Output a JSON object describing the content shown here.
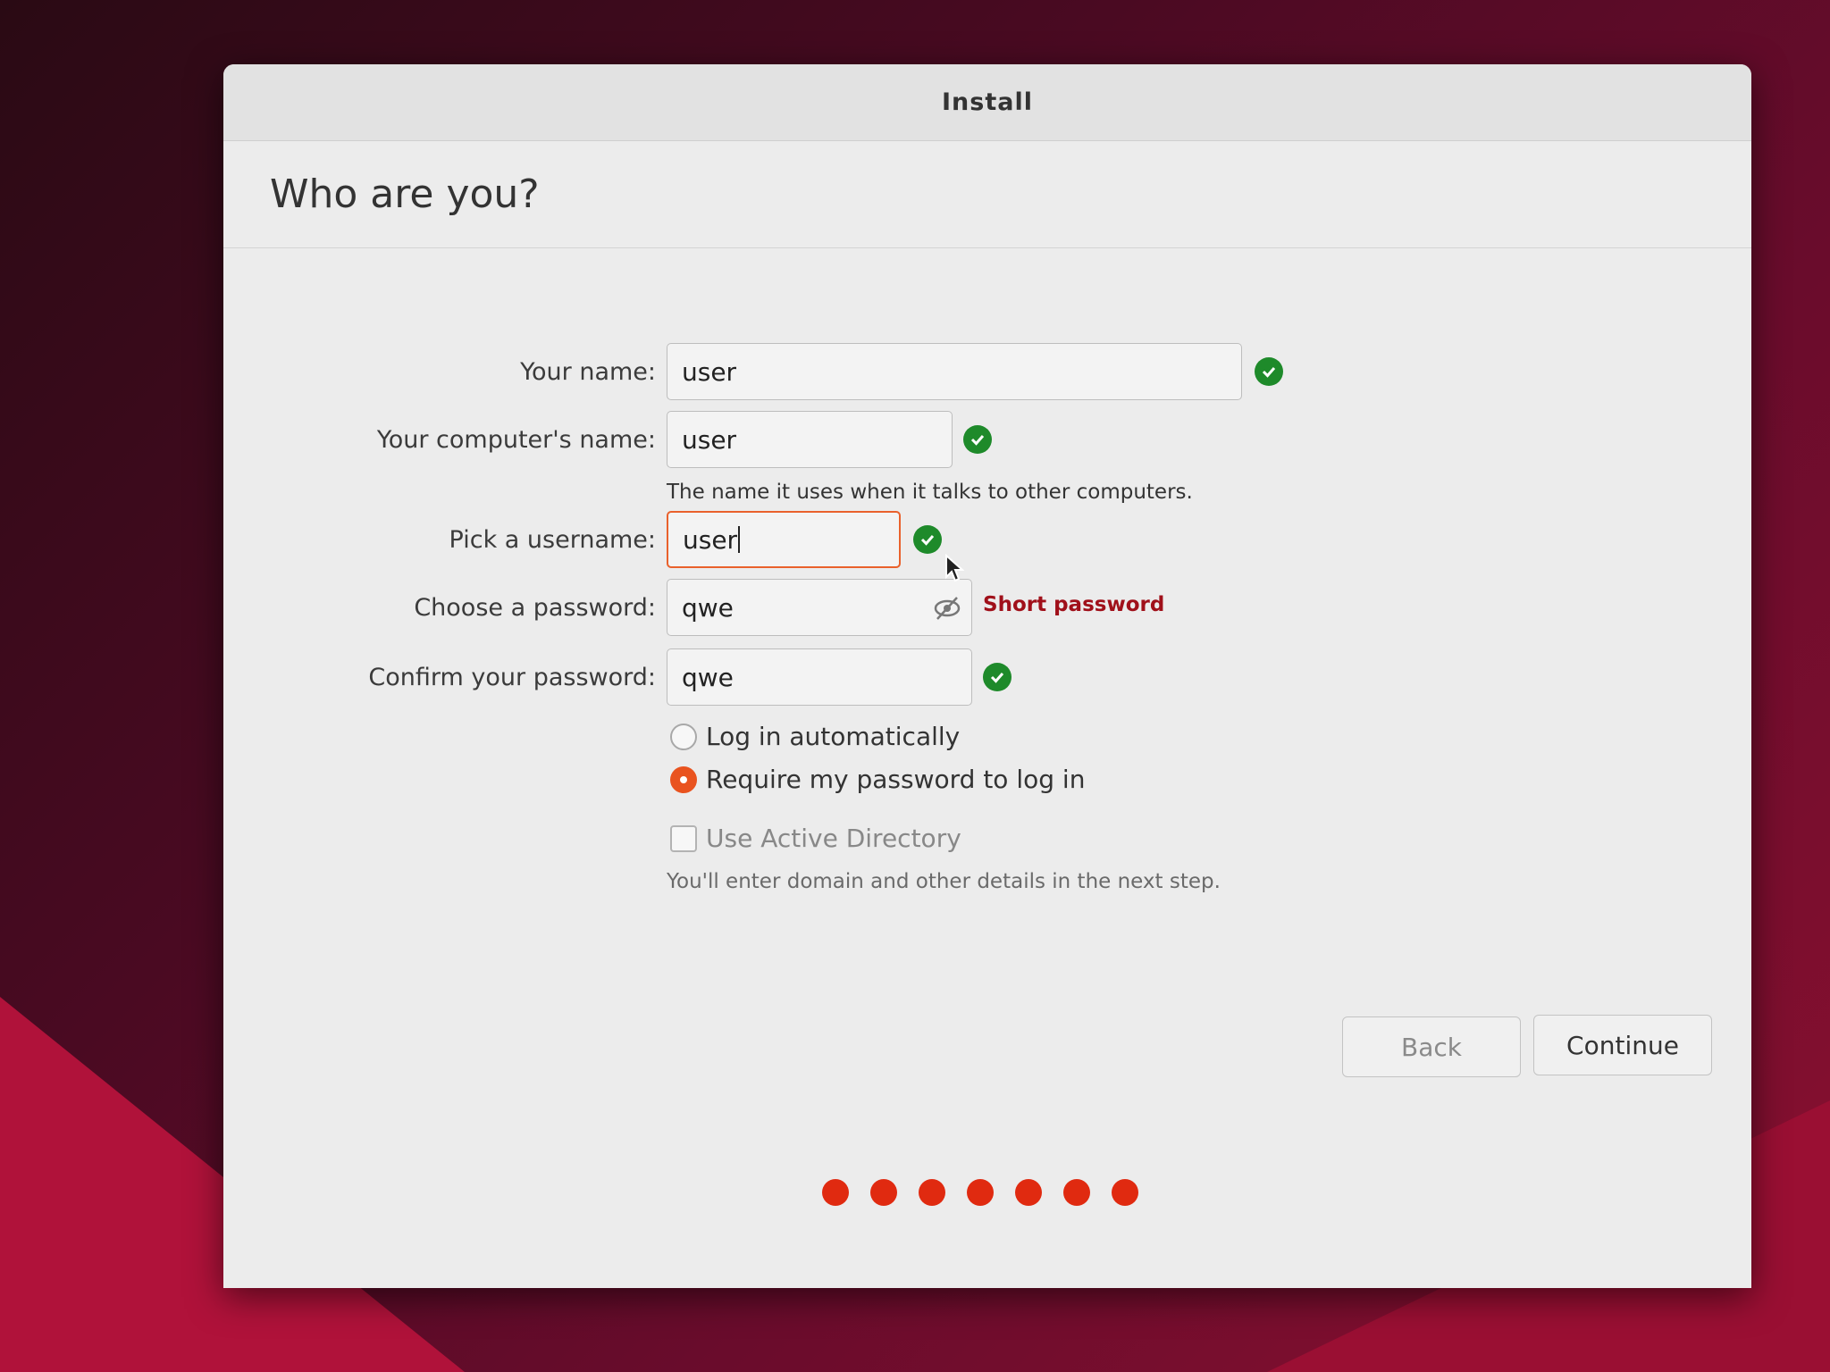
{
  "window": {
    "title": "Install"
  },
  "page": {
    "heading": "Who are you?"
  },
  "form": {
    "name": {
      "label": "Your name:",
      "value": "user"
    },
    "computer": {
      "label": "Your computer's name:",
      "value": "user",
      "hint": "The name it uses when it talks to other computers."
    },
    "username": {
      "label": "Pick a username:",
      "value": "user"
    },
    "password": {
      "label": "Choose a password:",
      "value": "qwe",
      "warning": "Short password"
    },
    "confirm": {
      "label": "Confirm your password:",
      "value": "qwe"
    }
  },
  "login": {
    "auto_label": "Log in automatically",
    "require_label": "Require my password to log in",
    "selected": "require"
  },
  "ad": {
    "label": "Use Active Directory",
    "hint": "You'll enter domain and other details in the next step."
  },
  "buttons": {
    "back": "Back",
    "continue": "Continue"
  },
  "progress": {
    "steps": 7
  },
  "colors": {
    "accent": "#e9531f",
    "ok": "#1e8a2a",
    "warning": "#a0101a"
  }
}
